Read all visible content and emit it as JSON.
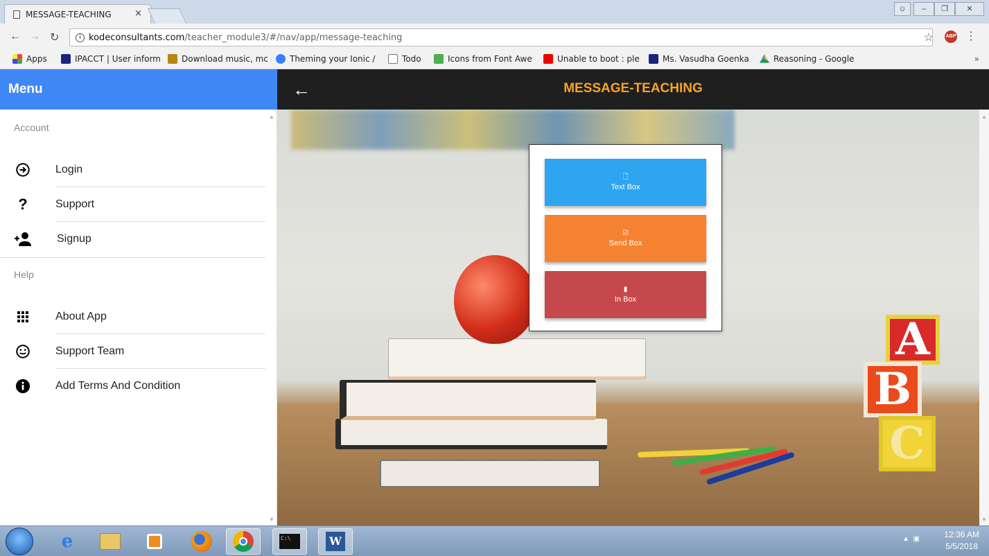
{
  "browser": {
    "tab_title": "MESSAGE-TEACHING",
    "tab_close": "×",
    "url_domain": "kodeconsultants.com",
    "url_path": "/teacher_module3/#/nav/app/message-teaching",
    "bookmarks": [
      {
        "label": "Apps",
        "icon": "apps-grid-icon",
        "color": "#e44"
      },
      {
        "label": "IPACCT | User inform",
        "icon": "ip-logo-icon",
        "color": "#1a237e"
      },
      {
        "label": "Download music, mc",
        "icon": "music-icon",
        "color": "#b8860b"
      },
      {
        "label": "Theming your Ionic /",
        "icon": "ionic-icon",
        "color": "#3880ff"
      },
      {
        "label": "Todo",
        "icon": "page-icon",
        "color": "#999"
      },
      {
        "label": "Icons from Font Awe",
        "icon": "w3-icon",
        "color": "#4caf50"
      },
      {
        "label": "Unable to boot : ple",
        "icon": "youtube-icon",
        "color": "#e00"
      },
      {
        "label": "Ms. Vasudha Goenka",
        "icon": "p-icon",
        "color": "#1a237e"
      },
      {
        "label": "Reasoning - Google",
        "icon": "drive-icon",
        "color": "#f4b400"
      }
    ],
    "bookmarks_more": "»"
  },
  "sidebar": {
    "title": "Menu",
    "section_account": "Account",
    "account_items": [
      {
        "label": "Login",
        "icon": "login-icon"
      },
      {
        "label": "Support",
        "icon": "help-icon"
      },
      {
        "label": "Signup",
        "icon": "person-add-icon"
      }
    ],
    "section_help": "Help",
    "help_items": [
      {
        "label": "About App",
        "icon": "apps-icon"
      },
      {
        "label": "Support Team",
        "icon": "smile-icon"
      },
      {
        "label": "Add Terms And Condition",
        "icon": "info-icon"
      }
    ]
  },
  "main": {
    "title": "MESSAGE-TEACHING",
    "buttons": [
      {
        "label": "Text Box",
        "icon": "document-icon",
        "color": "#2fa4ef"
      },
      {
        "label": "Send Box",
        "icon": "checkbox-icon",
        "color": "#f58231"
      },
      {
        "label": "In Box",
        "icon": "chat-icon",
        "color": "#c5494b"
      }
    ]
  },
  "taskbar": {
    "time": "12:36 AM",
    "date": "5/5/2018"
  }
}
